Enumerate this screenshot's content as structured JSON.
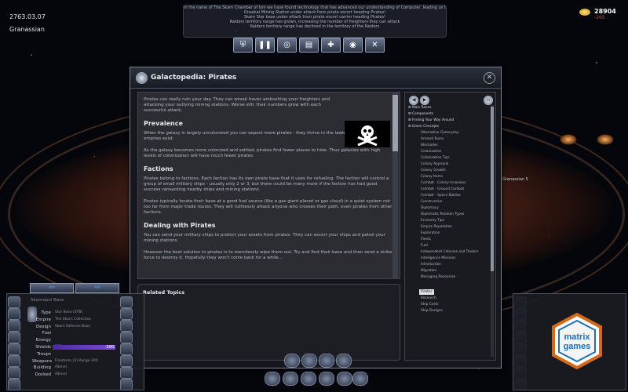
{
  "game_header": {
    "date": "2763.03.07",
    "empire_name": "Granassian",
    "credits": "28904",
    "credits_delta": "-265"
  },
  "news_ticker": [
    "In the name of The Skarn Chamber of Ism we have found technology that has advanced our understanding of Computer, leading us to devel",
    "Onaekai Mining Station under attack from pirate escort heading Pirates!",
    "Skarn Star base under attack from pirate escort carrier heading Pirates!",
    "Raiders territory range has grown, increasing the number of freighters they can attack",
    "Raiders territory range has declined in the territory of the Raiders"
  ],
  "toolbar": {
    "buttons": [
      "empire-button",
      "pause-button",
      "galaxy-button",
      "messages-button",
      "add-button",
      "research-button",
      "design-button"
    ]
  },
  "galactopedia": {
    "title": "Galactopedia: Pirates",
    "intro": "Pirates can really ruin your day. They can wreak havoc ambushing your freighters and attacking your outlying mining stations. Worse still, their numbers grow with each successful attack.",
    "sections": [
      {
        "heading": "Prevalence",
        "paragraphs": [
          "When the galaxy is largely uncolonized you can expect more pirates - they thrive in the lawless vacuum where no empires exist.",
          "As the galaxy becomes more colonized and settled, pirates find fewer places to hide. Thus galaxies with high levels of colonization will have much fewer pirates."
        ]
      },
      {
        "heading": "Factions",
        "paragraphs": [
          "Pirates belong to factions. Each faction has its own pirate base that it uses for refueling. The faction will control a group of small military ships - usually only 2 or 3, but there could be many more if the faction has had good success ransacking nearby ships and mining stations.",
          "Pirates typically locate their base at a good fuel source (like a gas giant planet or gas cloud) in a quiet system not too far from major trade routes. They will ruthlessly attack anyone who crosses their path, even pirates from other factions."
        ]
      },
      {
        "heading": "Dealing with Pirates",
        "paragraphs": [
          "You can send your military ships to protect your assets from pirates. They can escort your ships and patrol your mining stations.",
          "However the best solution to pirates is to mercilessly wipe them out. Try and find their base and then send a strike force to destroy it. Hopefully they won't come back for a while..."
        ]
      }
    ],
    "related_title": "Related Topics",
    "toc": [
      {
        "label": "Main Races",
        "level": "top"
      },
      {
        "label": "Components",
        "level": "top"
      },
      {
        "label": "Finding Your Way Around",
        "level": "top"
      },
      {
        "label": "Game Concepts",
        "level": "top"
      },
      {
        "label": "Alternative Game-play",
        "level": "sub"
      },
      {
        "label": "Ancient Ruins",
        "level": "sub"
      },
      {
        "label": "Blockades",
        "level": "sub"
      },
      {
        "label": "Colonization",
        "level": "sub"
      },
      {
        "label": "Colonization Tips",
        "level": "sub"
      },
      {
        "label": "Colony Approval",
        "level": "sub"
      },
      {
        "label": "Colony Growth",
        "level": "sub"
      },
      {
        "label": "Colony Items",
        "level": "sub"
      },
      {
        "label": "Combat - Colony Invasions",
        "level": "sub"
      },
      {
        "label": "Combat - Ground Combat",
        "level": "sub"
      },
      {
        "label": "Combat - Space Battles",
        "level": "sub"
      },
      {
        "label": "Construction",
        "level": "sub"
      },
      {
        "label": "Diplomacy",
        "level": "sub"
      },
      {
        "label": "Diplomatic Relation Types",
        "level": "sub"
      },
      {
        "label": "Economy Tips",
        "level": "sub"
      },
      {
        "label": "Empire Reputation",
        "level": "sub"
      },
      {
        "label": "Exploration",
        "level": "sub"
      },
      {
        "label": "Fleets",
        "level": "sub"
      },
      {
        "label": "Fuel",
        "level": "sub"
      },
      {
        "label": "Independent Colonies and Traders",
        "level": "sub"
      },
      {
        "label": "Intelligence Missions",
        "level": "sub"
      },
      {
        "label": "Introduction",
        "level": "sub"
      },
      {
        "label": "Migration",
        "level": "sub"
      },
      {
        "label": "Managing Resources",
        "level": "sub"
      },
      {
        "label": "Pirates",
        "level": "selected"
      },
      {
        "label": "Research",
        "level": "sub"
      },
      {
        "label": "Ship Costs",
        "level": "sub"
      },
      {
        "label": "Ship Designs",
        "level": "sub"
      }
    ]
  },
  "selection_panel": {
    "name": "Skarnopol Base",
    "rows": [
      {
        "label": "Type",
        "value": "Star Base (STB)"
      },
      {
        "label": "Empire",
        "value": "The Skarn Collective"
      },
      {
        "label": "Design",
        "value": "Skarn Defense Base"
      },
      {
        "label": "Fuel",
        "value": ""
      },
      {
        "label": "Energy",
        "value": ""
      },
      {
        "label": "Shields",
        "value": "390"
      },
      {
        "label": "Troops",
        "value": ""
      },
      {
        "label": "Weapons",
        "value": "Firestorm (3) Range 300"
      },
      {
        "label": "Building",
        "value": "(None)"
      },
      {
        "label": "Docked",
        "value": "(None)"
      }
    ],
    "shields_max": "390"
  },
  "map_labels": {
    "system_label": "Granassian 5"
  },
  "logo": {
    "text_top": "matrix",
    "text_bottom": "games"
  }
}
